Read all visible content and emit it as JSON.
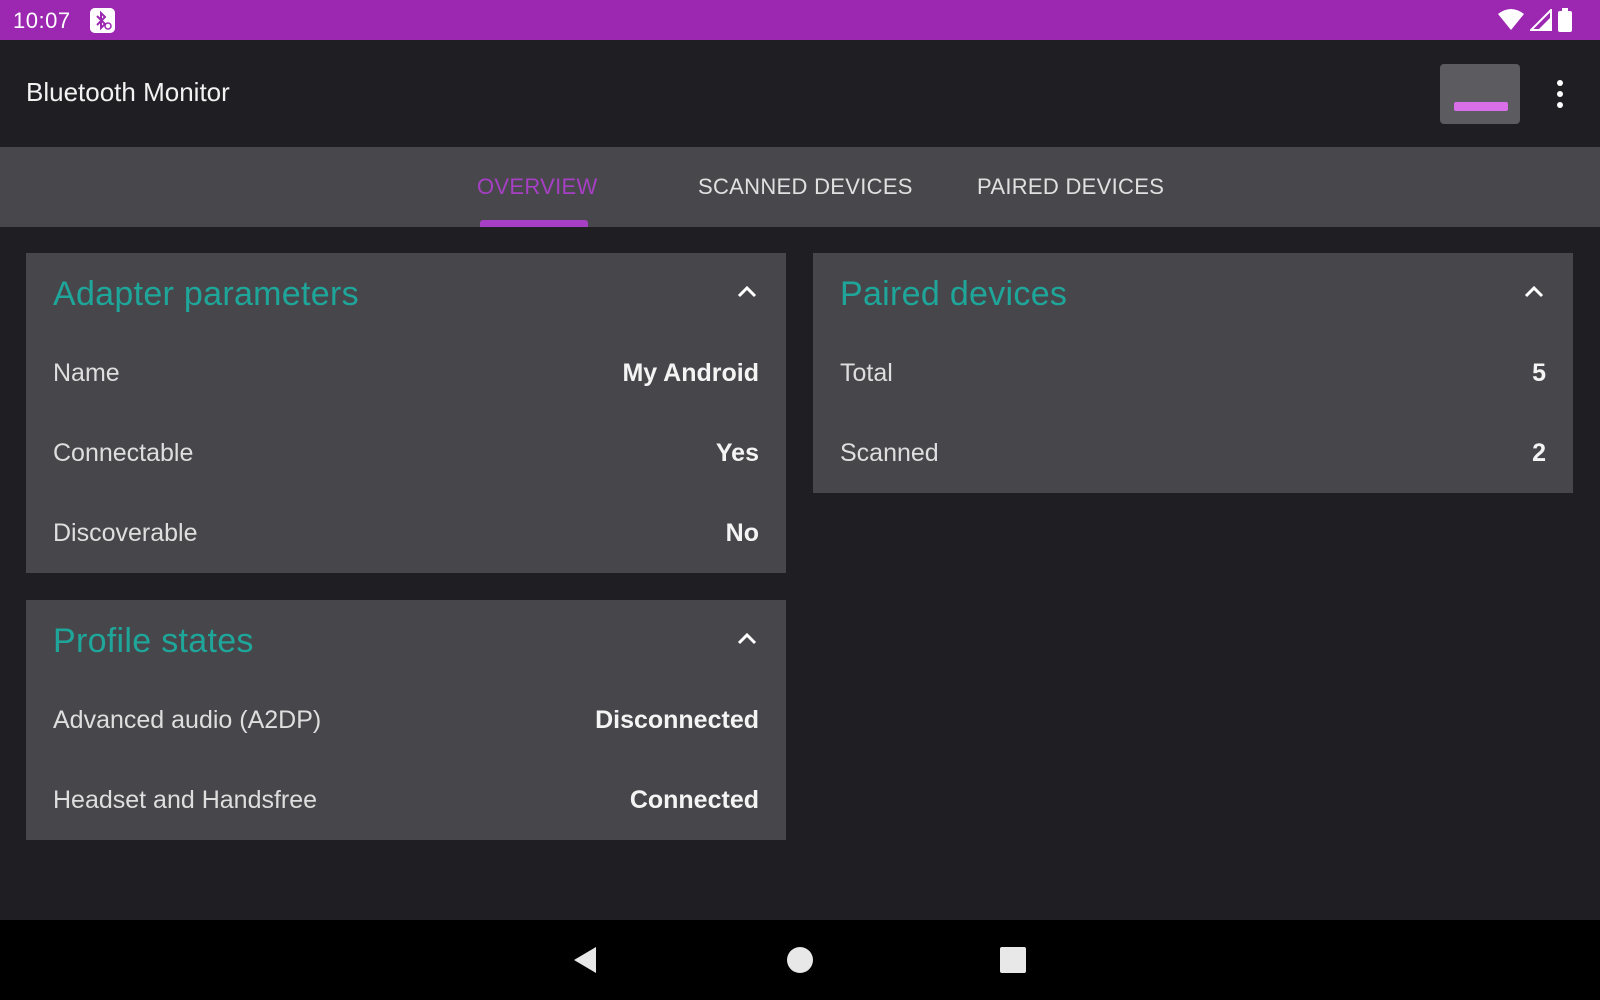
{
  "status_bar": {
    "time": "10:07",
    "notification_icon": "bluetooth-monitor-icon",
    "icons": [
      "wifi-icon",
      "signal-icon",
      "battery-icon"
    ],
    "color": "#9c27b0"
  },
  "app_bar": {
    "title": "Bluetooth Monitor",
    "overflow_icon": "more-vert-icon"
  },
  "tabs": [
    {
      "label": "OVERVIEW",
      "active": true
    },
    {
      "label": "SCANNED DEVICES",
      "active": false
    },
    {
      "label": "PAIRED DEVICES",
      "active": false
    }
  ],
  "accent_color": "#a63fc4",
  "card_title_color": "#1fa69a",
  "adapter": {
    "title": "Adapter parameters",
    "rows": [
      {
        "label": "Name",
        "value": "My Android"
      },
      {
        "label": "Connectable",
        "value": "Yes"
      },
      {
        "label": "Discoverable",
        "value": "No"
      }
    ]
  },
  "profiles": {
    "title": "Profile states",
    "rows": [
      {
        "label": "Advanced audio (A2DP)",
        "value": "Disconnected"
      },
      {
        "label": "Headset and Handsfree",
        "value": "Connected"
      }
    ]
  },
  "paired": {
    "title": "Paired devices",
    "rows": [
      {
        "label": "Total",
        "value": "5"
      },
      {
        "label": "Scanned",
        "value": "2"
      }
    ]
  },
  "nav_bar": {
    "buttons": [
      "back-icon",
      "home-icon",
      "recents-icon"
    ]
  }
}
